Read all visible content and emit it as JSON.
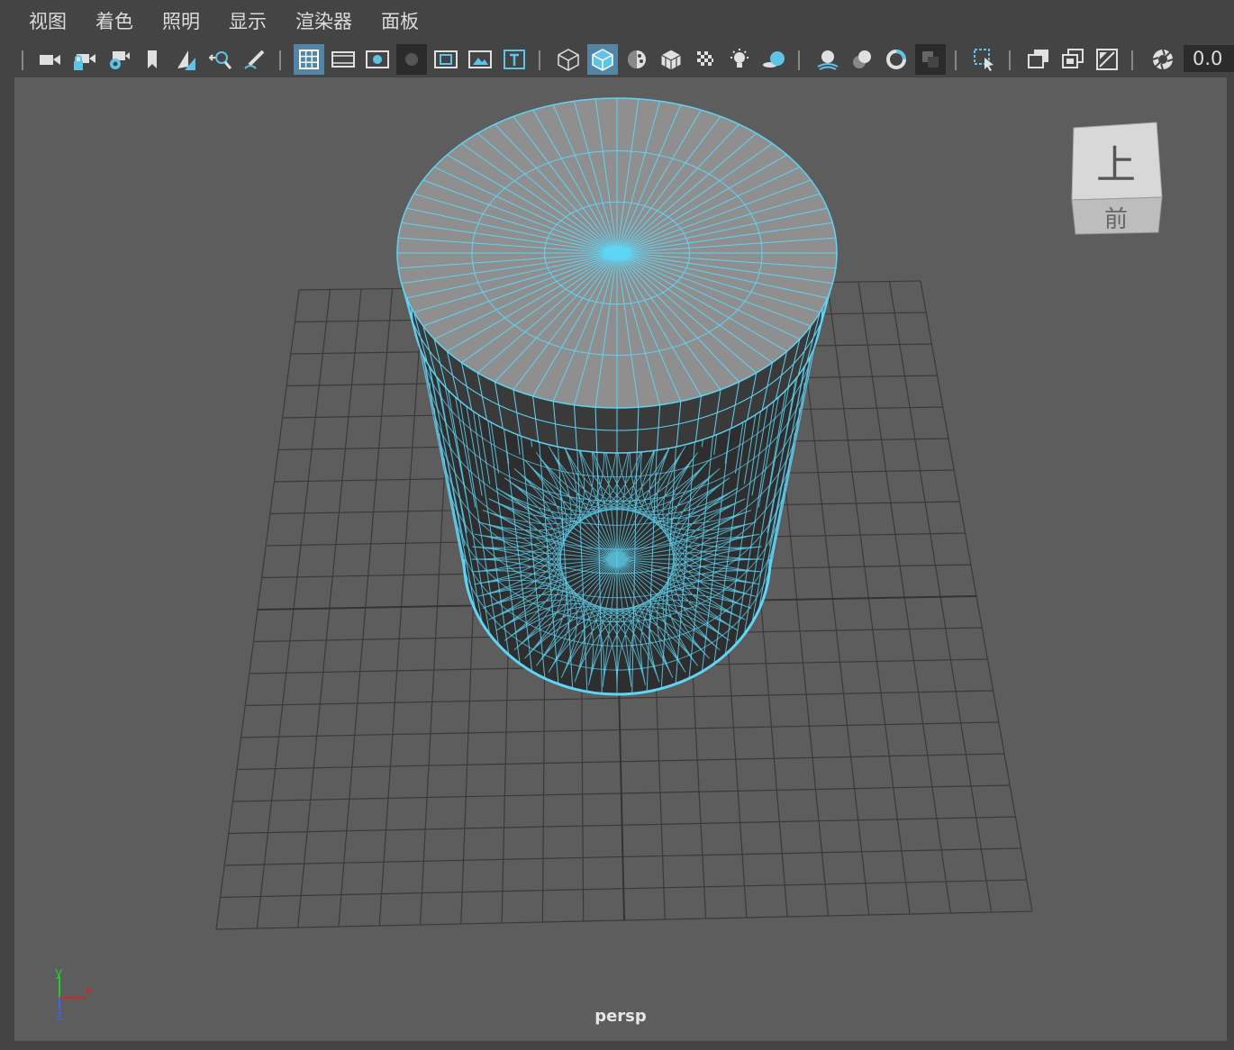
{
  "menubar": {
    "items": [
      {
        "label": "视图"
      },
      {
        "label": "着色"
      },
      {
        "label": "照明"
      },
      {
        "label": "显示"
      },
      {
        "label": "渲染器"
      },
      {
        "label": "面板"
      }
    ]
  },
  "toolbar": {
    "field_value": "0.0",
    "icons": [
      "select-camera-icon",
      "lock-camera-icon",
      "camera-attributes-icon",
      "bookmark-icon",
      "image-plane-icon",
      "2d-pan-zoom-icon",
      "grease-pencil-icon",
      "grid-icon",
      "film-gate-icon",
      "resolution-gate-icon",
      "gate-mask-icon",
      "field-chart-icon",
      "safe-action-icon",
      "safe-title-icon",
      "wireframe-icon",
      "smooth-shade-icon",
      "default-material-icon",
      "wireframe-on-shaded-icon",
      "xray-icon",
      "use-all-lights-icon",
      "shadows-icon",
      "screen-space-ao-icon",
      "motion-blur-icon",
      "antialiasing-icon",
      "depth-of-field-icon",
      "isolate-select-icon",
      "xray-joints-icon",
      "xray-active-components-icon",
      "image-icon",
      "exposure-icon"
    ]
  },
  "viewport": {
    "camera_label": "persp",
    "viewcube": {
      "top_label": "上",
      "front_label": "前"
    },
    "axis": {
      "x": "x",
      "y": "y",
      "z": "z"
    }
  },
  "colors": {
    "wireframe": "#5fd4f5",
    "grid": "#3a3a3a",
    "viewport_bg": "#5d5d5d",
    "chrome": "#444444",
    "active_button": "#5285a6",
    "axis_x": "#e02020",
    "axis_y": "#20d020",
    "axis_z": "#4060ff"
  }
}
